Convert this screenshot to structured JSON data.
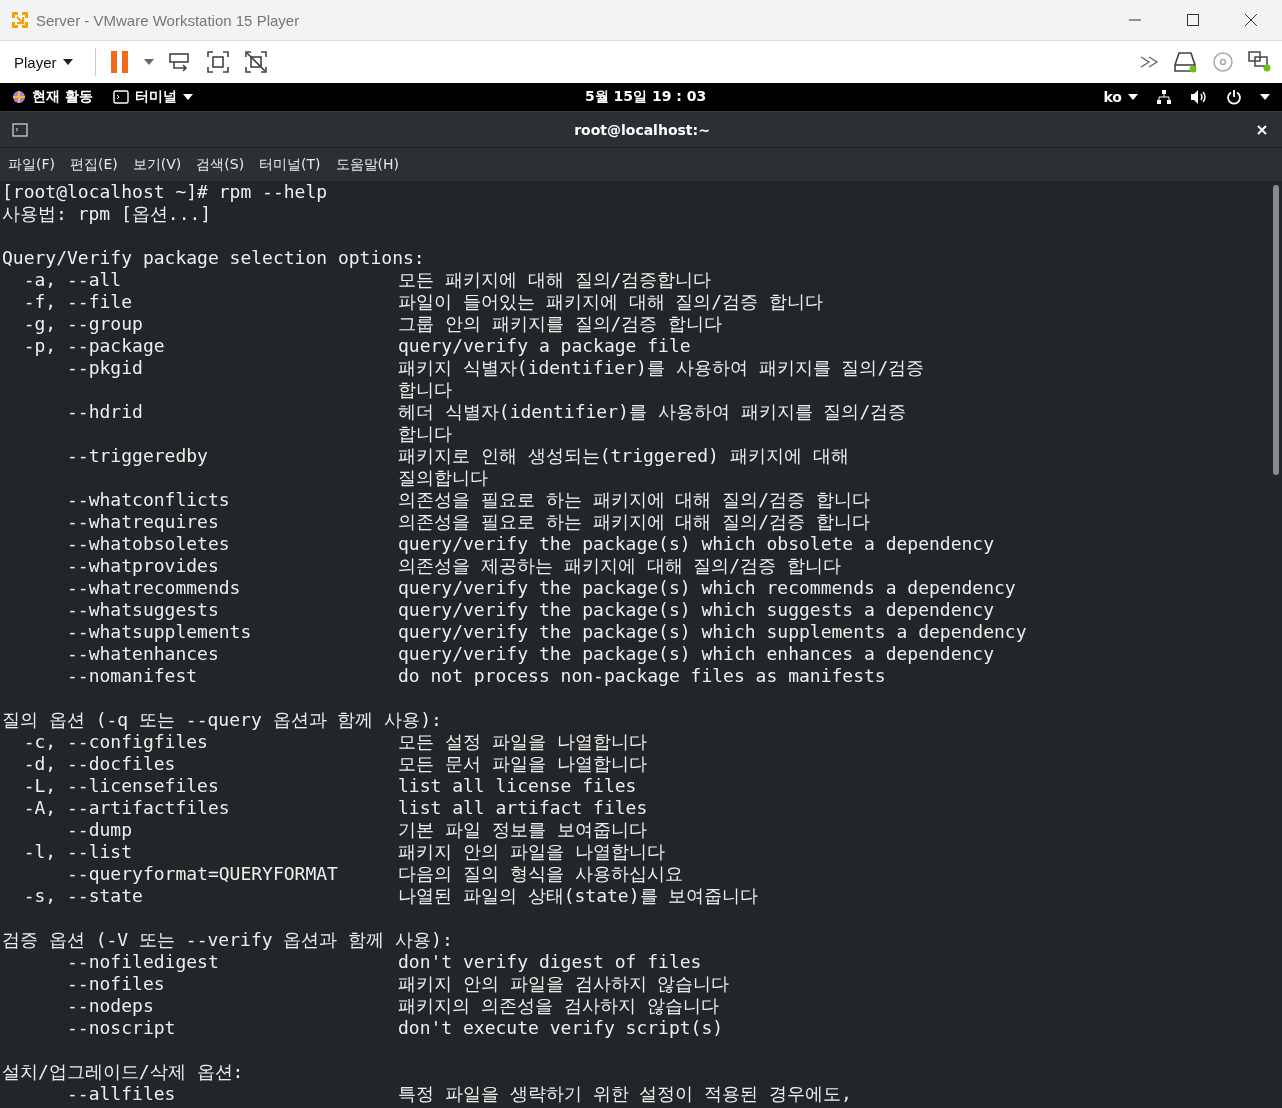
{
  "window": {
    "title": "Server - VMware Workstation 15 Player"
  },
  "toolbar": {
    "player_menu": "Player"
  },
  "gnome_bar": {
    "activities": "현재 활동",
    "app_menu": "터미널",
    "clock": "5월 15일  19 : 03",
    "input_method": "ko"
  },
  "terminal": {
    "title": "root@localhost:~",
    "menu": [
      "파일(F)",
      "편집(E)",
      "보기(V)",
      "검색(S)",
      "터미널(T)",
      "도움말(H)"
    ],
    "lines": [
      {
        "kind": "text",
        "text": "[root@localhost ~]# rpm --help"
      },
      {
        "kind": "text",
        "text": "사용법: rpm [옵션...]"
      },
      {
        "kind": "blank"
      },
      {
        "kind": "text",
        "text": "Query/Verify package selection options:"
      },
      {
        "kind": "option",
        "option": "  -a, --all",
        "desc": "모든 패키지에 대해 질의/검증합니다"
      },
      {
        "kind": "option",
        "option": "  -f, --file",
        "desc": "파일이 들어있는 패키지에 대해 질의/검증 합니다"
      },
      {
        "kind": "option",
        "option": "  -g, --group",
        "desc": "그룹 안의 패키지를 질의/검증 합니다"
      },
      {
        "kind": "option",
        "option": "  -p, --package",
        "desc": "query/verify a package file"
      },
      {
        "kind": "option",
        "option": "      --pkgid",
        "desc": "패키지 식별자(identifier)를 사용하여 패키지를 질의/검증"
      },
      {
        "kind": "option",
        "desc": "합니다"
      },
      {
        "kind": "option",
        "option": "      --hdrid",
        "desc": "헤더 식별자(identifier)를 사용하여 패키지를 질의/검증"
      },
      {
        "kind": "option",
        "desc": "합니다"
      },
      {
        "kind": "option",
        "option": "      --triggeredby",
        "desc": "패키지로 인해 생성되는(triggered) 패키지에 대해"
      },
      {
        "kind": "option",
        "desc": "질의합니다"
      },
      {
        "kind": "option",
        "option": "      --whatconflicts",
        "desc": "의존성을 필요로 하는 패키지에 대해 질의/검증 합니다"
      },
      {
        "kind": "option",
        "option": "      --whatrequires",
        "desc": "의존성을 필요로 하는 패키지에 대해 질의/검증 합니다"
      },
      {
        "kind": "option",
        "option": "      --whatobsoletes",
        "desc": "query/verify the package(s) which obsolete a dependency"
      },
      {
        "kind": "option",
        "option": "      --whatprovides",
        "desc": "의존성을 제공하는 패키지에 대해 질의/검증 합니다"
      },
      {
        "kind": "option",
        "option": "      --whatrecommends",
        "desc": "query/verify the package(s) which recommends a dependency"
      },
      {
        "kind": "option",
        "option": "      --whatsuggests",
        "desc": "query/verify the package(s) which suggests a dependency"
      },
      {
        "kind": "option",
        "option": "      --whatsupplements",
        "desc": "query/verify the package(s) which supplements a dependency"
      },
      {
        "kind": "option",
        "option": "      --whatenhances",
        "desc": "query/verify the package(s) which enhances a dependency"
      },
      {
        "kind": "option",
        "option": "      --nomanifest",
        "desc": "do not process non-package files as manifests"
      },
      {
        "kind": "blank"
      },
      {
        "kind": "text",
        "text": "질의 옵션 (-q 또는 --query 옵션과 함께 사용):"
      },
      {
        "kind": "option",
        "option": "  -c, --configfiles",
        "desc": "모든 설정 파일을 나열합니다"
      },
      {
        "kind": "option",
        "option": "  -d, --docfiles",
        "desc": "모든 문서 파일을 나열합니다"
      },
      {
        "kind": "option",
        "option": "  -L, --licensefiles",
        "desc": "list all license files"
      },
      {
        "kind": "option",
        "option": "  -A, --artifactfiles",
        "desc": "list all artifact files"
      },
      {
        "kind": "option",
        "option": "      --dump",
        "desc": "기본 파일 정보를 보여줍니다"
      },
      {
        "kind": "option",
        "option": "  -l, --list",
        "desc": "패키지 안의 파일을 나열합니다"
      },
      {
        "kind": "option",
        "option": "      --queryformat=QUERYFORMAT",
        "desc": "다음의 질의 형식을 사용하십시요"
      },
      {
        "kind": "option",
        "option": "  -s, --state",
        "desc": "나열된 파일의 상태(state)를 보여줍니다"
      },
      {
        "kind": "blank"
      },
      {
        "kind": "text",
        "text": "검증 옵션 (-V 또는 --verify 옵션과 함께 사용):"
      },
      {
        "kind": "option",
        "option": "      --nofiledigest",
        "desc": "don't verify digest of files"
      },
      {
        "kind": "option",
        "option": "      --nofiles",
        "desc": "패키지 안의 파일을 검사하지 않습니다"
      },
      {
        "kind": "option",
        "option": "      --nodeps",
        "desc": "패키지의 의존성을 검사하지 않습니다"
      },
      {
        "kind": "option",
        "option": "      --noscript",
        "desc": "don't execute verify script(s)"
      },
      {
        "kind": "blank"
      },
      {
        "kind": "text",
        "text": "설치/업그레이드/삭제 옵션:"
      },
      {
        "kind": "option",
        "option": "      --allfiles",
        "desc": "특정 파일을 생략하기 위한 설정이 적용된 경우에도,"
      }
    ]
  }
}
